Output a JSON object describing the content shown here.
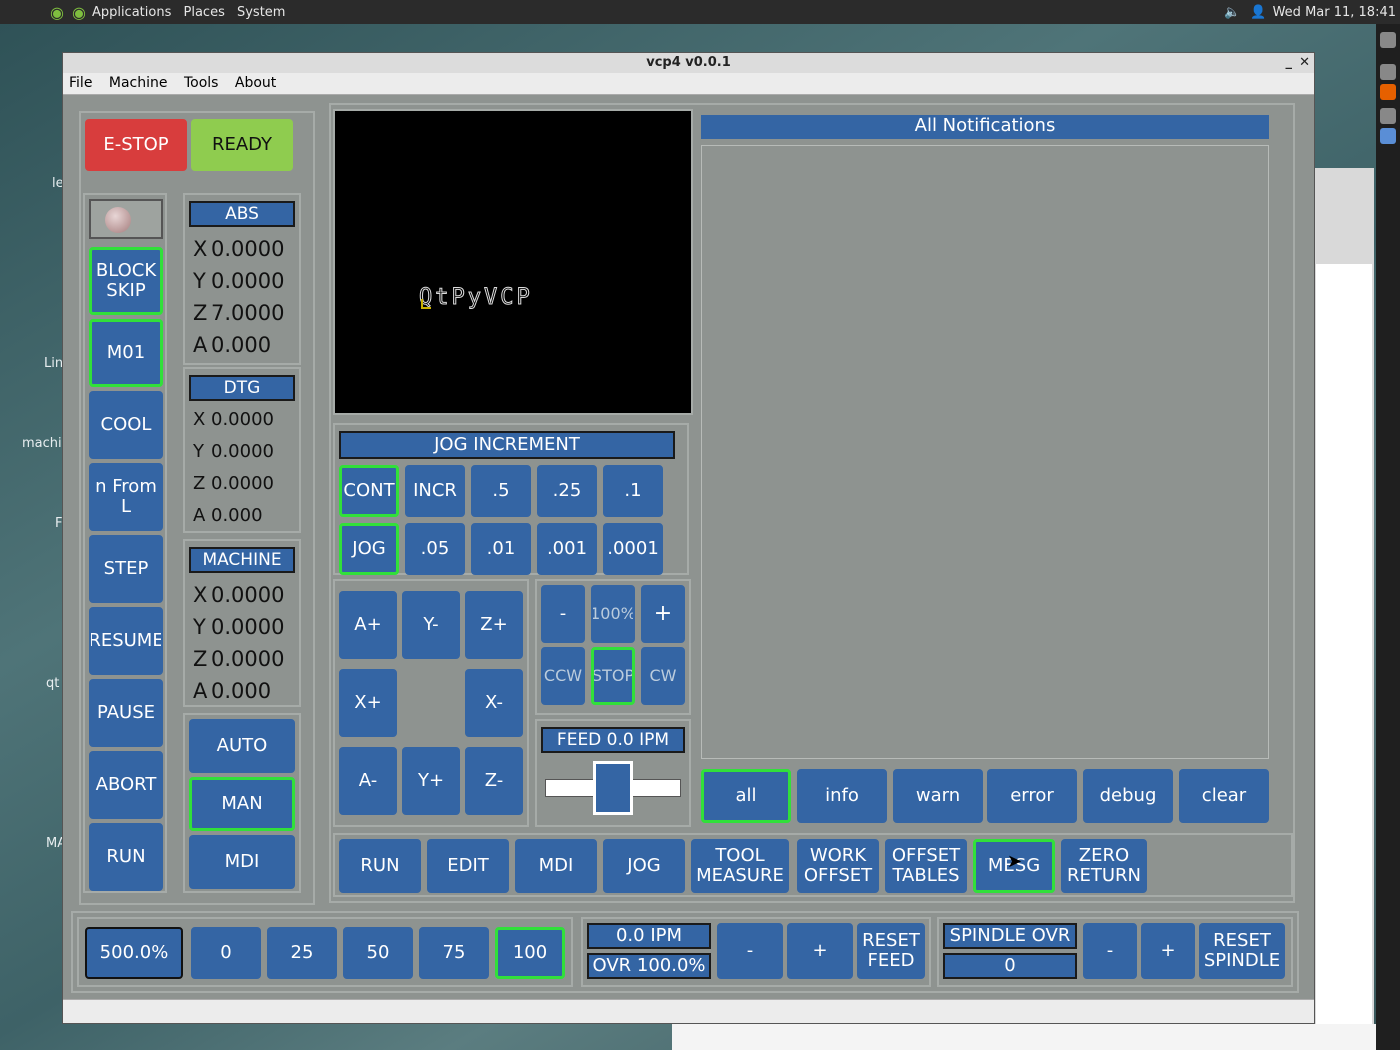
{
  "top_panel": {
    "menus": [
      "Applications",
      "Places",
      "System"
    ],
    "clock": "Wed Mar 11, 18:41"
  },
  "desktop_labels": [
    "le",
    "Lin",
    "machi",
    "F",
    "qt",
    "MA"
  ],
  "window": {
    "title": "vcp4 v0.0.1"
  },
  "menubar": [
    "File",
    "Machine",
    "Tools",
    "About"
  ],
  "estop": {
    "label": "E-STOP",
    "color": "#d83d3d"
  },
  "ready": {
    "label": "READY",
    "color": "#8fcc4f"
  },
  "left_buttons": [
    "BLOCK\nSKIP",
    "M01",
    "COOL",
    "n From L",
    "STEP",
    "RESUME",
    "PAUSE",
    "ABORT",
    "RUN"
  ],
  "dro": {
    "abs": {
      "title": "ABS",
      "rows": [
        {
          "axis": "X",
          "value": "0.0000"
        },
        {
          "axis": "Y",
          "value": "0.0000"
        },
        {
          "axis": "Z",
          "value": "7.0000"
        },
        {
          "axis": "A",
          "value": "0.000"
        }
      ]
    },
    "dtg": {
      "title": "DTG",
      "rows": [
        {
          "axis": "X",
          "value": "0.0000"
        },
        {
          "axis": "Y",
          "value": "0.0000"
        },
        {
          "axis": "Z",
          "value": "0.0000"
        },
        {
          "axis": "A",
          "value": "0.000"
        }
      ]
    },
    "machine": {
      "title": "MACHINE",
      "rows": [
        {
          "axis": "X",
          "value": "0.0000"
        },
        {
          "axis": "Y",
          "value": "0.0000"
        },
        {
          "axis": "Z",
          "value": "0.0000"
        },
        {
          "axis": "A",
          "value": "0.000"
        }
      ]
    }
  },
  "modes": [
    "AUTO",
    "MAN",
    "MDI"
  ],
  "preview_logo": "QtPyVCP",
  "jog_increment": {
    "title": "JOG INCREMENT",
    "row1": [
      "CONT",
      "INCR",
      ".5",
      ".25",
      ".1"
    ],
    "row2": [
      "JOG",
      ".05",
      ".01",
      ".001",
      ".0001"
    ]
  },
  "jog_buttons": [
    "A+",
    "Y-",
    "Z+",
    "X+",
    "X-",
    "A-",
    "Y+",
    "Z-"
  ],
  "spindle": {
    "minus": "-",
    "percent": "100%",
    "plus": "+",
    "ccw": "CCW",
    "stop": "STOP",
    "cw": "CW"
  },
  "feed": {
    "label": "FEED 0.0  IPM",
    "slider_percent": 50
  },
  "notifications": {
    "title": "All Notifications",
    "filters": [
      "all",
      "info",
      "warn",
      "error",
      "debug",
      "clear"
    ]
  },
  "bottom_tabs": [
    "RUN",
    "EDIT",
    "MDI",
    "JOG",
    "TOOL\nMEASURE",
    "WORK\nOFFSET",
    "OFFSET\nTABLES",
    "MESG",
    "ZERO\nRETURN"
  ],
  "rapid": {
    "value": "500.0%",
    "presets": [
      "0",
      "25",
      "50",
      "75",
      "100"
    ]
  },
  "feed_override": {
    "ipm": "0.0  IPM",
    "ovr": "OVR 100.0%",
    "minus": "-",
    "plus": "+",
    "reset": "RESET\nFEED"
  },
  "spindle_override": {
    "title": "SPINDLE OVR",
    "value": "0",
    "minus": "-",
    "plus": "+",
    "reset": "RESET\nSPINDLE"
  }
}
